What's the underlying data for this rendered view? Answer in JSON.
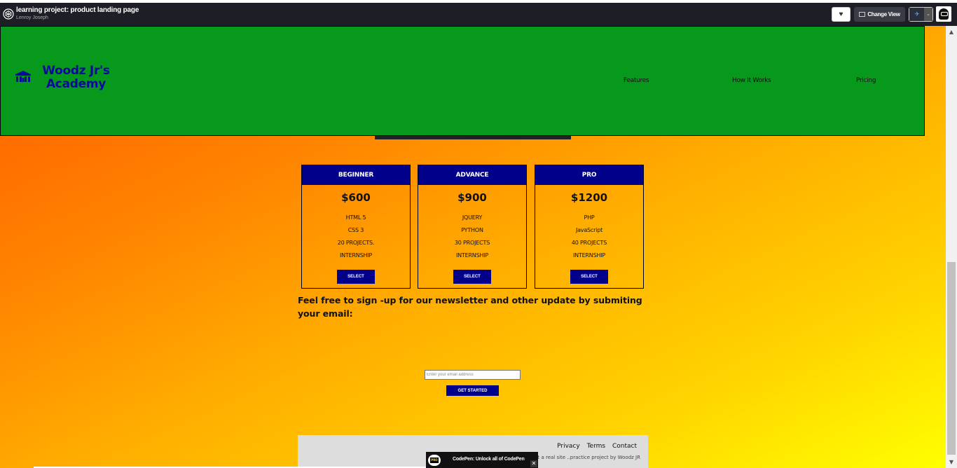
{
  "codepen": {
    "title": "learning project: product landing page",
    "author": "Lenroy Joseph",
    "change_view_label": "Change View",
    "heart_icon": "♥",
    "pin_icon": "✈",
    "chevron_icon": "⌄",
    "promo_text": "CodePen: Unlock all of CodePen",
    "promo_badge": "PRO",
    "promo_close": "✕"
  },
  "scrollbar": {
    "up": "▲",
    "down": "▼"
  },
  "header": {
    "brand_name": "Woodz Jr's Academy",
    "nav": [
      "Features",
      "How It Works",
      "Pricing"
    ],
    "bg_color": "#07991b"
  },
  "pricing": [
    {
      "name": "BEGINNER",
      "price": "$600",
      "features": [
        "HTML 5",
        "CSS 3",
        "20 PROJECTS.",
        "INTERNSHIP"
      ],
      "button": "SELECT"
    },
    {
      "name": "ADVANCE",
      "price": "$900",
      "features": [
        "JQUERY",
        "PYTHON",
        "30 PROJECTS",
        "INTERNSHIP"
      ],
      "button": "SELECT"
    },
    {
      "name": "PRO",
      "price": "$1200",
      "features": [
        "PHP",
        "JavaScript",
        "40 PROJECTS",
        "INTERNSHIP"
      ],
      "button": "SELECT"
    }
  ],
  "newsletter": {
    "text": "Feel free to sign -up for our newsletter and other update by submiting your email:",
    "email_placeholder": "Enter your email address",
    "email_value": "",
    "submit_label": "GET STARTED"
  },
  "footer": {
    "links": [
      "Privacy",
      "Terms",
      "Contact"
    ],
    "note": "not a real site ..practice project by Woodz JR"
  },
  "colors": {
    "accent": "#00008b",
    "gradient_start": "#ff5a00",
    "gradient_end": "#ffff00"
  }
}
